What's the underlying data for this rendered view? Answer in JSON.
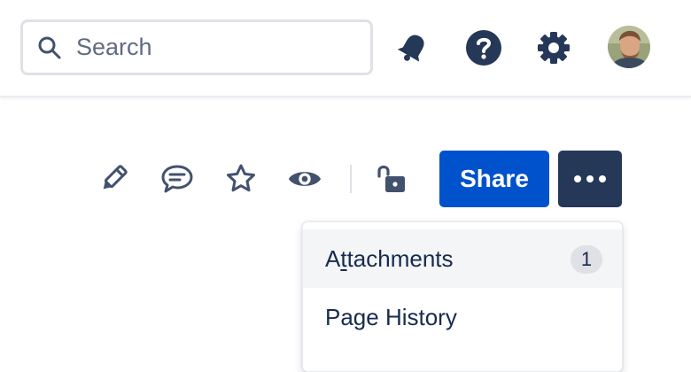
{
  "topbar": {
    "search": {
      "placeholder": "Search"
    },
    "icons": [
      "bell-icon",
      "help-icon",
      "settings-icon"
    ]
  },
  "toolbar": {
    "tools": [
      "edit-icon",
      "comment-icon",
      "star-icon",
      "watch-icon",
      "unlock-icon"
    ],
    "share_label": "Share",
    "more_label": "•••"
  },
  "menu": {
    "items": [
      {
        "label_pre": "A",
        "label_u": "t",
        "label_post": "tachments",
        "badge": "1"
      },
      {
        "label": "Page History"
      }
    ]
  },
  "colors": {
    "primary": "#0052cc",
    "dark": "#253858",
    "icon": "#42526e",
    "text": "#172b4d"
  }
}
